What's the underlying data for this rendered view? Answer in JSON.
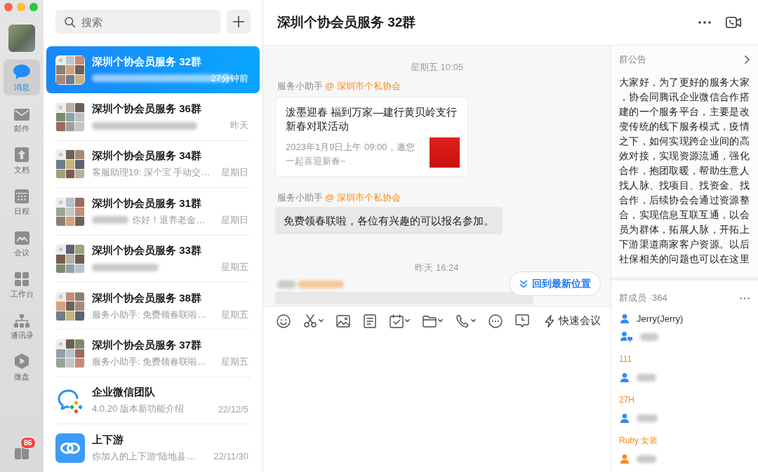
{
  "nav": {
    "items": [
      {
        "label": "消息",
        "selected": true
      },
      {
        "label": "邮件",
        "selected": false
      },
      {
        "label": "文档",
        "selected": false
      },
      {
        "label": "日程",
        "selected": false
      },
      {
        "label": "会议",
        "selected": false
      },
      {
        "label": "工作台",
        "selected": false
      },
      {
        "label": "通讯录",
        "selected": false
      },
      {
        "label": "微盘",
        "selected": false
      }
    ],
    "badge": "86"
  },
  "chat_list": {
    "search": {
      "placeholder": "搜索"
    },
    "conversations": [
      {
        "kind": "group",
        "name": "深圳个协会员服务 32群",
        "sender_blurred": true,
        "time": "27分钟前",
        "selected": true
      },
      {
        "kind": "group",
        "name": "深圳个协会员服务 36群",
        "sender_blurred": true,
        "time": "昨天",
        "selected": false
      },
      {
        "kind": "group",
        "name": "深圳个协会员服务 34群",
        "sender_blurred": false,
        "preview": "客服助理19: 深个宝 手动交…",
        "time": "星期日",
        "selected": false
      },
      {
        "kind": "group",
        "name": "深圳个协会员服务 31群",
        "sender_blurred": true,
        "preview": "你好！退养老金…",
        "time": "星期日",
        "selected": false
      },
      {
        "kind": "group",
        "name": "深圳个协会员服务 33群",
        "sender_blurred": true,
        "time": "星期五",
        "selected": false
      },
      {
        "kind": "group",
        "name": "深圳个协会员服务 38群",
        "sender_blurred": false,
        "preview": "服务小助手: 免费领春联啦…",
        "time": "星期五",
        "selected": false
      },
      {
        "kind": "group",
        "name": "深圳个协会员服务 37群",
        "sender_blurred": false,
        "preview": "服务小助手: 免费领春联啦…",
        "time": "星期五",
        "selected": false
      },
      {
        "kind": "wecom",
        "name": "企业微信团队",
        "sender_blurred": false,
        "preview": "4.0.20 版本新功能介绍",
        "time": "22/12/5",
        "selected": false
      },
      {
        "kind": "link",
        "name": "上下游",
        "sender_blurred": false,
        "preview": "你加入的上下游“陆地县…",
        "time": "22/11/30",
        "selected": false
      }
    ]
  },
  "chat": {
    "title": "深圳个协会员服务 32群",
    "messages": [
      {
        "kind": "time",
        "text": "星期五 10:05"
      },
      {
        "kind": "card",
        "sender": "服务小助手",
        "org": "@ 深圳市个私协会",
        "title": "泼墨迎春 福到万家—建行黄贝岭支行新春对联活动",
        "description": "2023年1月9日上午 09:00，邀您一起喜迎新春~"
      },
      {
        "kind": "text",
        "sender": "服务小助手",
        "org": "@ 深圳市个私协会",
        "text": "免费领春联啦，各位有兴趣的可以报名参加。"
      },
      {
        "kind": "time",
        "text": "昨天 16:24"
      },
      {
        "kind": "clipped"
      }
    ],
    "jump_button": "回到最新位置",
    "toolbar": {
      "quick_meeting": "快速会议"
    }
  },
  "side": {
    "notice": {
      "title": "群公告",
      "text": "大家好，为了更好的服务大家，协会同腾讯企业微信合作搭建的一个服务平台，主要是改变传统的线下服务模式，疫情之下，如何实现跨企业间的高效对接，实现资源流通，强化合作，抱团取暖，帮助生意人找人脉、找项目、找资金、找合作，后续协会会通过资源整合，实现信息互联互通，以会员为群体，拓展人脉，开拓上下游渠道商家客户资源。以后社保相关的问题也可以在这里"
    },
    "members": {
      "title": "群成员 ·364",
      "items": [
        {
          "kind": "member",
          "name": "Jerry(Jerry)",
          "color": "#2f8cf3"
        },
        {
          "kind": "member_pc",
          "color": "#2f8cf3"
        },
        {
          "kind": "remark",
          "text": "111"
        },
        {
          "kind": "member",
          "color": "#2f8cf3"
        },
        {
          "kind": "remark",
          "text": "27H"
        },
        {
          "kind": "member",
          "color": "#2f8cf3"
        },
        {
          "kind": "remark",
          "text": "Ruby 女装"
        },
        {
          "kind": "member",
          "color": "#f5891f"
        }
      ]
    }
  }
}
